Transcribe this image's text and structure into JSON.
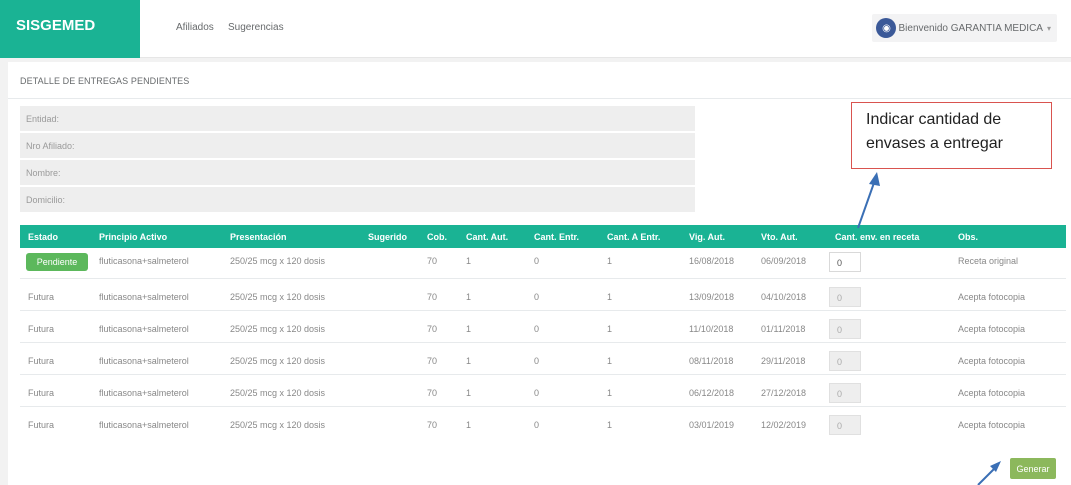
{
  "header": {
    "brand": "SISGEMED",
    "nav": [
      "Afiliados",
      "Sugerencias"
    ],
    "user_label": "Bienvenido GARANTIA MEDICA",
    "user_caret": "▾"
  },
  "panel": {
    "title": "DETALLE DE ENTREGAS PENDIENTES",
    "fields": [
      "Entidad:",
      "Nro Afiliado:",
      "Nombre:",
      "Domicilio:"
    ]
  },
  "table": {
    "headers": [
      "Estado",
      "Principio Activo",
      "Presentación",
      "Sugerido",
      "Cob.",
      "Cant. Aut.",
      "Cant. Entr.",
      "Cant. A Entr.",
      "Vig. Aut.",
      "Vto. Aut.",
      "Cant. env. en receta",
      "Obs."
    ],
    "rows": [
      {
        "estado": "Pendiente",
        "principio": "fluticasona+salmeterol",
        "presentacion": "250/25 mcg x 120 dosis",
        "sugerido": "",
        "cob": "70",
        "cant_aut": "1",
        "cant_entr": "0",
        "cant_a_entr": "1",
        "vig": "16/08/2018",
        "vto": "06/09/2018",
        "env": "0",
        "obs": "Receta original"
      },
      {
        "estado": "Futura",
        "principio": "fluticasona+salmeterol",
        "presentacion": "250/25 mcg x 120 dosis",
        "sugerido": "",
        "cob": "70",
        "cant_aut": "1",
        "cant_entr": "0",
        "cant_a_entr": "1",
        "vig": "13/09/2018",
        "vto": "04/10/2018",
        "env": "0",
        "obs": "Acepta fotocopia"
      },
      {
        "estado": "Futura",
        "principio": "fluticasona+salmeterol",
        "presentacion": "250/25 mcg x 120 dosis",
        "sugerido": "",
        "cob": "70",
        "cant_aut": "1",
        "cant_entr": "0",
        "cant_a_entr": "1",
        "vig": "11/10/2018",
        "vto": "01/11/2018",
        "env": "0",
        "obs": "Acepta fotocopia"
      },
      {
        "estado": "Futura",
        "principio": "fluticasona+salmeterol",
        "presentacion": "250/25 mcg x 120 dosis",
        "sugerido": "",
        "cob": "70",
        "cant_aut": "1",
        "cant_entr": "0",
        "cant_a_entr": "1",
        "vig": "08/11/2018",
        "vto": "29/11/2018",
        "env": "0",
        "obs": "Acepta fotocopia"
      },
      {
        "estado": "Futura",
        "principio": "fluticasona+salmeterol",
        "presentacion": "250/25 mcg x 120 dosis",
        "sugerido": "",
        "cob": "70",
        "cant_aut": "1",
        "cant_entr": "0",
        "cant_a_entr": "1",
        "vig": "06/12/2018",
        "vto": "27/12/2018",
        "env": "0",
        "obs": "Acepta fotocopia"
      },
      {
        "estado": "Futura",
        "principio": "fluticasona+salmeterol",
        "presentacion": "250/25 mcg x 120 dosis",
        "sugerido": "",
        "cob": "70",
        "cant_aut": "1",
        "cant_entr": "0",
        "cant_a_entr": "1",
        "vig": "03/01/2019",
        "vto": "12/02/2019",
        "env": "0",
        "obs": "Acepta fotocopia"
      }
    ]
  },
  "actions": {
    "generar": "Generar"
  },
  "callout": {
    "line1": "Indicar cantidad de",
    "line2": "envases a entregar"
  },
  "colors": {
    "accent": "#1ab394",
    "pendiente": "#5cb85c",
    "generar": "#8cb85c",
    "callout_border": "#d9534f",
    "arrow": "#3a6fb5"
  }
}
